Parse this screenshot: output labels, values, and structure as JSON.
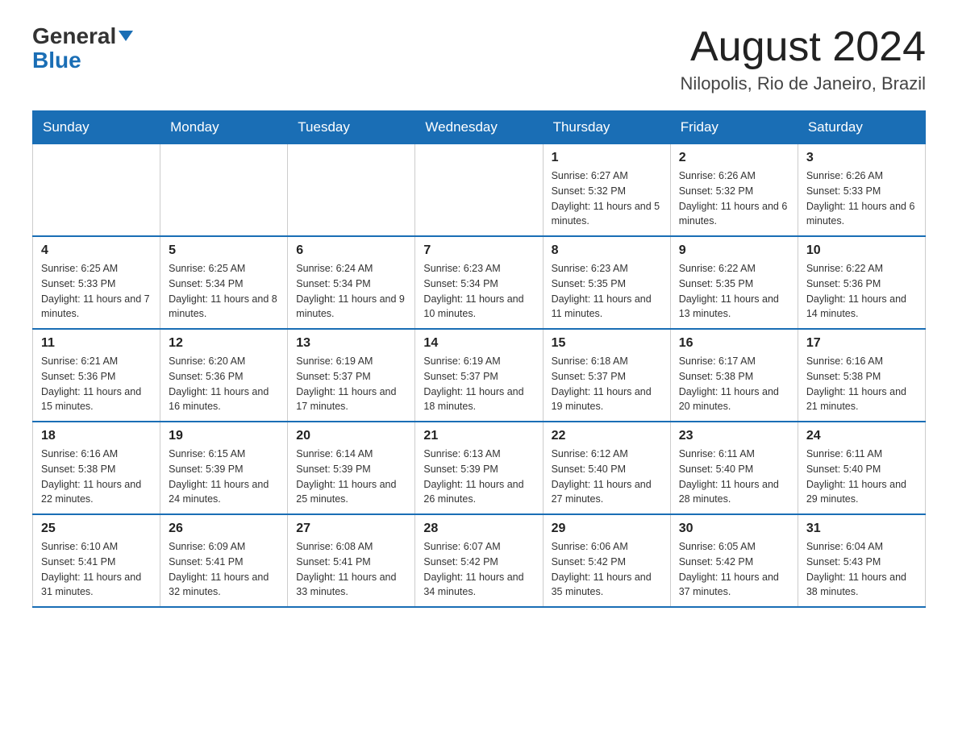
{
  "header": {
    "logo_main": "General",
    "logo_sub": "Blue",
    "month_title": "August 2024",
    "location": "Nilopolis, Rio de Janeiro, Brazil"
  },
  "weekdays": [
    "Sunday",
    "Monday",
    "Tuesday",
    "Wednesday",
    "Thursday",
    "Friday",
    "Saturday"
  ],
  "weeks": [
    [
      {
        "day": "",
        "info": ""
      },
      {
        "day": "",
        "info": ""
      },
      {
        "day": "",
        "info": ""
      },
      {
        "day": "",
        "info": ""
      },
      {
        "day": "1",
        "info": "Sunrise: 6:27 AM\nSunset: 5:32 PM\nDaylight: 11 hours and 5 minutes."
      },
      {
        "day": "2",
        "info": "Sunrise: 6:26 AM\nSunset: 5:32 PM\nDaylight: 11 hours and 6 minutes."
      },
      {
        "day": "3",
        "info": "Sunrise: 6:26 AM\nSunset: 5:33 PM\nDaylight: 11 hours and 6 minutes."
      }
    ],
    [
      {
        "day": "4",
        "info": "Sunrise: 6:25 AM\nSunset: 5:33 PM\nDaylight: 11 hours and 7 minutes."
      },
      {
        "day": "5",
        "info": "Sunrise: 6:25 AM\nSunset: 5:34 PM\nDaylight: 11 hours and 8 minutes."
      },
      {
        "day": "6",
        "info": "Sunrise: 6:24 AM\nSunset: 5:34 PM\nDaylight: 11 hours and 9 minutes."
      },
      {
        "day": "7",
        "info": "Sunrise: 6:23 AM\nSunset: 5:34 PM\nDaylight: 11 hours and 10 minutes."
      },
      {
        "day": "8",
        "info": "Sunrise: 6:23 AM\nSunset: 5:35 PM\nDaylight: 11 hours and 11 minutes."
      },
      {
        "day": "9",
        "info": "Sunrise: 6:22 AM\nSunset: 5:35 PM\nDaylight: 11 hours and 13 minutes."
      },
      {
        "day": "10",
        "info": "Sunrise: 6:22 AM\nSunset: 5:36 PM\nDaylight: 11 hours and 14 minutes."
      }
    ],
    [
      {
        "day": "11",
        "info": "Sunrise: 6:21 AM\nSunset: 5:36 PM\nDaylight: 11 hours and 15 minutes."
      },
      {
        "day": "12",
        "info": "Sunrise: 6:20 AM\nSunset: 5:36 PM\nDaylight: 11 hours and 16 minutes."
      },
      {
        "day": "13",
        "info": "Sunrise: 6:19 AM\nSunset: 5:37 PM\nDaylight: 11 hours and 17 minutes."
      },
      {
        "day": "14",
        "info": "Sunrise: 6:19 AM\nSunset: 5:37 PM\nDaylight: 11 hours and 18 minutes."
      },
      {
        "day": "15",
        "info": "Sunrise: 6:18 AM\nSunset: 5:37 PM\nDaylight: 11 hours and 19 minutes."
      },
      {
        "day": "16",
        "info": "Sunrise: 6:17 AM\nSunset: 5:38 PM\nDaylight: 11 hours and 20 minutes."
      },
      {
        "day": "17",
        "info": "Sunrise: 6:16 AM\nSunset: 5:38 PM\nDaylight: 11 hours and 21 minutes."
      }
    ],
    [
      {
        "day": "18",
        "info": "Sunrise: 6:16 AM\nSunset: 5:38 PM\nDaylight: 11 hours and 22 minutes."
      },
      {
        "day": "19",
        "info": "Sunrise: 6:15 AM\nSunset: 5:39 PM\nDaylight: 11 hours and 24 minutes."
      },
      {
        "day": "20",
        "info": "Sunrise: 6:14 AM\nSunset: 5:39 PM\nDaylight: 11 hours and 25 minutes."
      },
      {
        "day": "21",
        "info": "Sunrise: 6:13 AM\nSunset: 5:39 PM\nDaylight: 11 hours and 26 minutes."
      },
      {
        "day": "22",
        "info": "Sunrise: 6:12 AM\nSunset: 5:40 PM\nDaylight: 11 hours and 27 minutes."
      },
      {
        "day": "23",
        "info": "Sunrise: 6:11 AM\nSunset: 5:40 PM\nDaylight: 11 hours and 28 minutes."
      },
      {
        "day": "24",
        "info": "Sunrise: 6:11 AM\nSunset: 5:40 PM\nDaylight: 11 hours and 29 minutes."
      }
    ],
    [
      {
        "day": "25",
        "info": "Sunrise: 6:10 AM\nSunset: 5:41 PM\nDaylight: 11 hours and 31 minutes."
      },
      {
        "day": "26",
        "info": "Sunrise: 6:09 AM\nSunset: 5:41 PM\nDaylight: 11 hours and 32 minutes."
      },
      {
        "day": "27",
        "info": "Sunrise: 6:08 AM\nSunset: 5:41 PM\nDaylight: 11 hours and 33 minutes."
      },
      {
        "day": "28",
        "info": "Sunrise: 6:07 AM\nSunset: 5:42 PM\nDaylight: 11 hours and 34 minutes."
      },
      {
        "day": "29",
        "info": "Sunrise: 6:06 AM\nSunset: 5:42 PM\nDaylight: 11 hours and 35 minutes."
      },
      {
        "day": "30",
        "info": "Sunrise: 6:05 AM\nSunset: 5:42 PM\nDaylight: 11 hours and 37 minutes."
      },
      {
        "day": "31",
        "info": "Sunrise: 6:04 AM\nSunset: 5:43 PM\nDaylight: 11 hours and 38 minutes."
      }
    ]
  ]
}
